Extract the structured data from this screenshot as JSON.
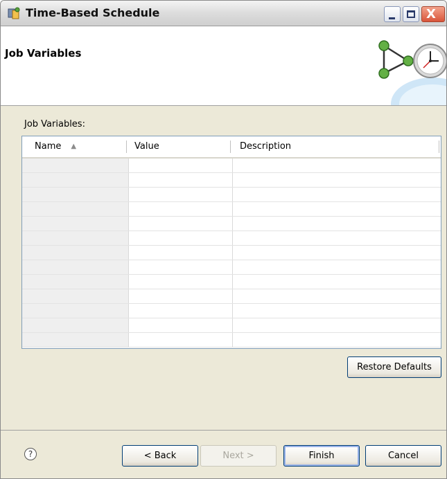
{
  "window": {
    "title": "Time-Based Schedule",
    "controls": [
      "minimize-icon",
      "maximize-icon",
      "close-icon"
    ],
    "close_glyph": "X"
  },
  "header": {
    "title": "Job Variables",
    "graphic": "schedule-clock-graphic"
  },
  "section": {
    "label": "Job Variables:"
  },
  "table": {
    "columns": [
      "Name",
      "Value",
      "Description"
    ],
    "sorted_column": "Name",
    "sort_direction": "ascending",
    "rows": [
      [
        "",
        "",
        ""
      ],
      [
        "",
        "",
        ""
      ],
      [
        "",
        "",
        ""
      ],
      [
        "",
        "",
        ""
      ],
      [
        "",
        "",
        ""
      ],
      [
        "",
        "",
        ""
      ],
      [
        "",
        "",
        ""
      ],
      [
        "",
        "",
        ""
      ],
      [
        "",
        "",
        ""
      ],
      [
        "",
        "",
        ""
      ],
      [
        "",
        "",
        ""
      ],
      [
        "",
        "",
        ""
      ],
      [
        "",
        "",
        ""
      ]
    ]
  },
  "buttons": {
    "restore_defaults": "Restore Defaults",
    "help": "?",
    "back": "< Back",
    "next": "Next >",
    "finish": "Finish",
    "cancel": "Cancel"
  },
  "colors": {
    "dialog_bg": "#ece9d8",
    "header_bg": "#ffffff",
    "name_column_bg": "#efefef",
    "close_button": "#d9553a"
  }
}
